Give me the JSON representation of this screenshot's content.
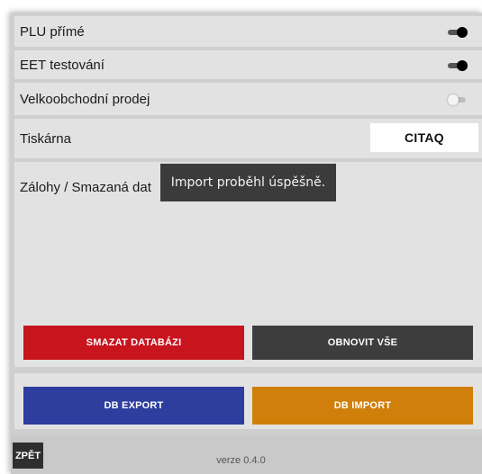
{
  "settings": {
    "plu_label": "PLU přímé",
    "plu_on": true,
    "eet_label": "EET testování",
    "eet_on": true,
    "wholesale_label": "Velkoobchodní prodej",
    "wholesale_on": false,
    "printer_label": "Tiskárna",
    "printer_value": "CITAQ"
  },
  "deposits": {
    "label": "Zálohy / Smazaná dat"
  },
  "toast": {
    "message": "Import proběhl úspěšně."
  },
  "actions": {
    "delete_db_label": "SMAZAT DATABÁZI",
    "delete_db_color": "#c8141d",
    "restore_all_label": "OBNOVIT VŠE",
    "restore_all_color": "#3d3d3d",
    "db_export_label": "DB EXPORT",
    "db_export_color": "#2d3e9e",
    "db_import_label": "DB IMPORT",
    "db_import_color": "#d07f0a"
  },
  "footer": {
    "back_label": "ZPĚT",
    "version": "verze 0.4.0"
  }
}
